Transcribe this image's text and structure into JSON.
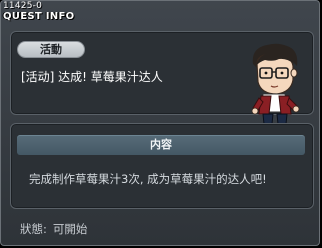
{
  "window": {
    "id": "11425-0",
    "title": "QUEST INFO"
  },
  "quest": {
    "category": "活動",
    "name": "[活动] 达成! 草莓果汁达人"
  },
  "content": {
    "header": "内容",
    "description": "完成制作草莓果汁3次, 成为草莓果汁的达人吧!"
  },
  "status": {
    "label": "狀態:",
    "value": "可開始"
  },
  "npc": {
    "icon": "npc-portrait-icon"
  },
  "colors": {
    "panel_bg": "#2b3035",
    "header_bg": "#4d6370",
    "badge_bg": "#c8cdd1",
    "text": "#ffffff"
  }
}
